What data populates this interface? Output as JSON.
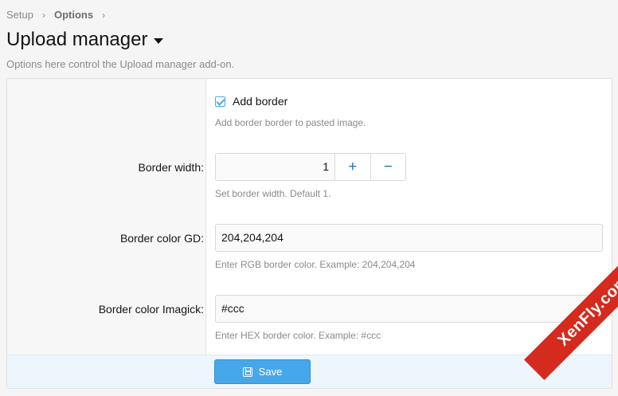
{
  "breadcrumb": {
    "items": [
      "Setup",
      "Options"
    ]
  },
  "page": {
    "title": "Upload manager",
    "description": "Options here control the Upload manager add-on."
  },
  "options": {
    "add_border": {
      "label": "Add border",
      "checked": true,
      "hint": "Add border border to pasted image."
    },
    "border_width": {
      "label": "Border width:",
      "value": "1",
      "increment": "+",
      "decrement": "−",
      "hint": "Set border width. Default 1."
    },
    "border_color_gd": {
      "label": "Border color GD:",
      "value": "204,204,204",
      "hint": "Enter RGB border color. Example: 204,204,204"
    },
    "border_color_imagick": {
      "label": "Border color Imagick:",
      "value": "#ccc",
      "hint": "Enter HEX border color. Example: #ccc"
    }
  },
  "footer": {
    "save_label": "Save"
  },
  "watermark": "XenFly.com",
  "colors": {
    "accent": "#47a7eb",
    "link": "#2577b1",
    "watermark": "#d52a1e"
  },
  "icons": {
    "title_toggle": "caret-down-icon",
    "save": "save-icon",
    "separator": "chevron-right-icon"
  }
}
